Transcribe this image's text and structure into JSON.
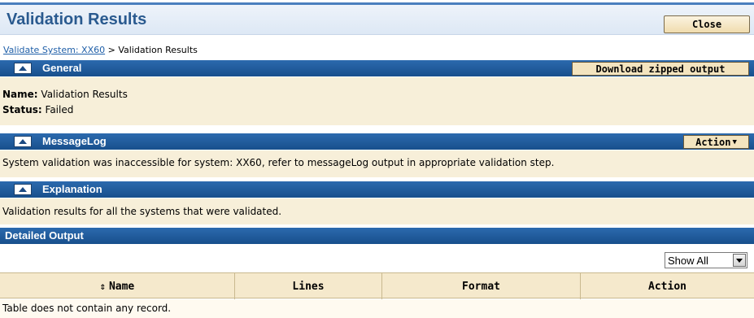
{
  "window": {
    "title": "Validation Results",
    "close_label": "Close"
  },
  "breadcrumb": {
    "link": "Validate System: XX60",
    "separator": ">",
    "current": "Validation Results"
  },
  "general": {
    "header": "General",
    "download_label": "Download zipped output",
    "name_label": "Name:",
    "name_value": "Validation Results",
    "status_label": "Status:",
    "status_value": "Failed"
  },
  "message_log": {
    "header": "MessageLog",
    "action_label": "Action",
    "message": "System validation was inaccessible for system: XX60, refer to messageLog output in appropriate validation step."
  },
  "explanation": {
    "header": "Explanation",
    "text": "Validation results for all the systems that were validated."
  },
  "detailed_output": {
    "header": "Detailed Output",
    "filter_value": "Show All",
    "columns": [
      "Name",
      "Lines",
      "Format",
      "Action"
    ],
    "empty_text": "Table does not contain any record."
  },
  "colors": {
    "header_blue": "#184f8c",
    "panel_tan": "#f7efd9",
    "title_blue": "#2a5a8f"
  },
  "icons": {
    "collapse": "triangle-up-icon",
    "dropdown": "chevron-down-icon",
    "sort": "sort-updown-icon"
  }
}
